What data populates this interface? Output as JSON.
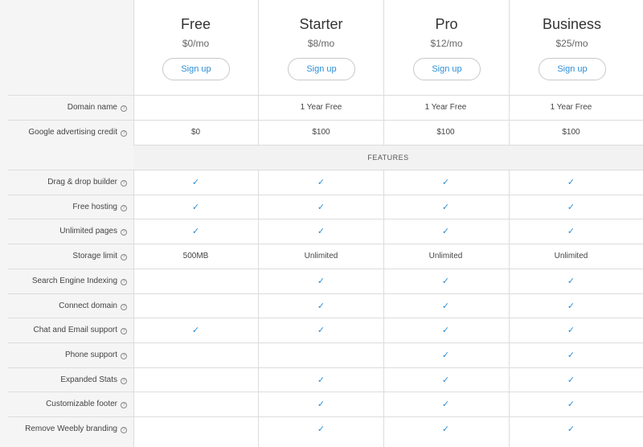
{
  "plans": [
    {
      "name": "Free",
      "price": "$0/mo",
      "signup": "Sign up"
    },
    {
      "name": "Starter",
      "price": "$8/mo",
      "signup": "Sign up"
    },
    {
      "name": "Pro",
      "price": "$12/mo",
      "signup": "Sign up"
    },
    {
      "name": "Business",
      "price": "$25/mo",
      "signup": "Sign up"
    }
  ],
  "top_rows": [
    {
      "label": "Domain name",
      "values": [
        "",
        "1 Year Free",
        "1 Year Free",
        "1 Year Free"
      ]
    },
    {
      "label": "Google advertising credit",
      "values": [
        "$0",
        "$100",
        "$100",
        "$100"
      ]
    }
  ],
  "features_header": "FEATURES",
  "feature_rows": [
    {
      "label": "Drag & drop builder",
      "values": [
        "✓",
        "✓",
        "✓",
        "✓"
      ]
    },
    {
      "label": "Free hosting",
      "values": [
        "✓",
        "✓",
        "✓",
        "✓"
      ]
    },
    {
      "label": "Unlimited pages",
      "values": [
        "✓",
        "✓",
        "✓",
        "✓"
      ]
    },
    {
      "label": "Storage limit",
      "values": [
        "500MB",
        "Unlimited",
        "Unlimited",
        "Unlimited"
      ]
    },
    {
      "label": "Search Engine Indexing",
      "values": [
        "",
        "✓",
        "✓",
        "✓"
      ]
    },
    {
      "label": "Connect domain",
      "values": [
        "",
        "✓",
        "✓",
        "✓"
      ]
    },
    {
      "label": "Chat and Email support",
      "values": [
        "✓",
        "✓",
        "✓",
        "✓"
      ]
    },
    {
      "label": "Phone support",
      "values": [
        "",
        "",
        "✓",
        "✓"
      ]
    },
    {
      "label": "Expanded Stats",
      "values": [
        "",
        "✓",
        "✓",
        "✓"
      ]
    },
    {
      "label": "Customizable footer",
      "values": [
        "",
        "✓",
        "✓",
        "✓"
      ]
    },
    {
      "label": "Remove Weebly branding",
      "values": [
        "",
        "✓",
        "✓",
        "✓"
      ]
    }
  ],
  "help_icon": "help-circle-icon",
  "check_icon": "checkmark-icon",
  "accent_color": "#2b8fd9"
}
